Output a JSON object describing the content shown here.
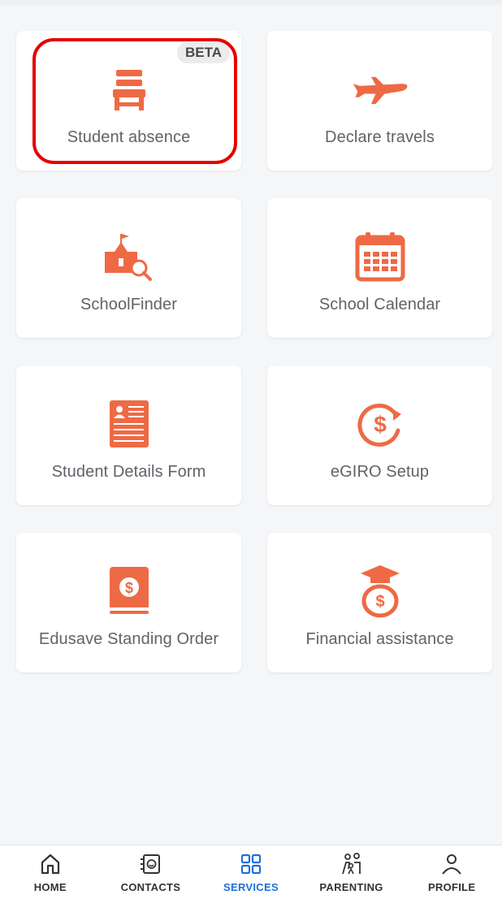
{
  "colors": {
    "accent": "#ee6a45",
    "active": "#1e6fd9",
    "highlight": "#e60000"
  },
  "services": [
    {
      "label": "Student absence",
      "icon": "chair-icon",
      "badge": "BETA"
    },
    {
      "label": "Declare travels",
      "icon": "airplane-icon"
    },
    {
      "label": "SchoolFinder",
      "icon": "school-search-icon"
    },
    {
      "label": "School Calendar",
      "icon": "calendar-icon"
    },
    {
      "label": "Student Details Form",
      "icon": "form-icon"
    },
    {
      "label": "eGIRO Setup",
      "icon": "recurring-payment-icon"
    },
    {
      "label": "Edusave Standing Order",
      "icon": "edusave-book-icon"
    },
    {
      "label": "Financial assistance",
      "icon": "graduation-money-bag-icon"
    }
  ],
  "nav": {
    "items": [
      {
        "label": "HOME",
        "icon": "home-icon"
      },
      {
        "label": "CONTACTS",
        "icon": "contacts-icon"
      },
      {
        "label": "SERVICES",
        "icon": "services-grid-icon",
        "active": true
      },
      {
        "label": "PARENTING",
        "icon": "parenting-icon"
      },
      {
        "label": "PROFILE",
        "icon": "profile-icon"
      }
    ]
  }
}
